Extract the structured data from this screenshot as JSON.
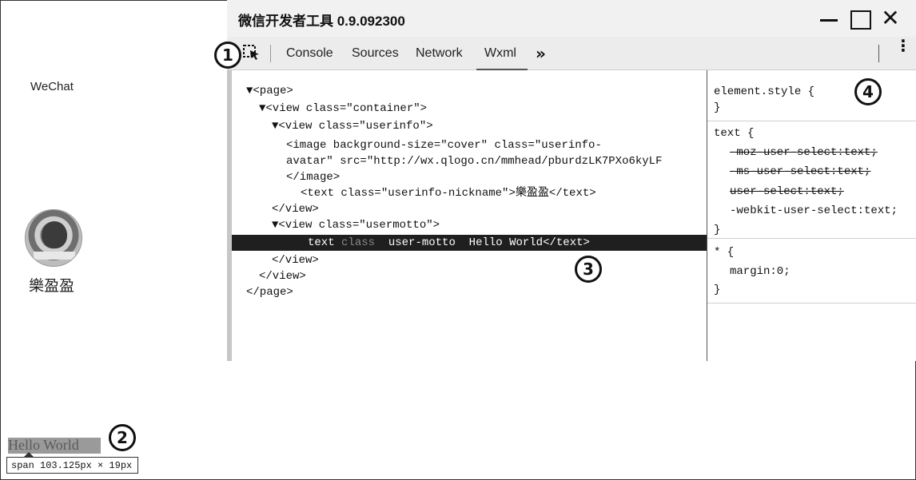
{
  "simulator": {
    "title": "WeChat",
    "nickname": "樂盈盈",
    "hello_text": "Hello World",
    "tooltip": "span 103.125px × 19px"
  },
  "window": {
    "title": "微信开发者工具 0.9.092300",
    "minimize_icon": "minimize-icon",
    "maximize_icon": "maximize-icon",
    "close_icon": "close-icon",
    "close_glyph": "✕"
  },
  "tabs": {
    "items": [
      "Console",
      "Sources",
      "Network",
      "Wxml"
    ],
    "active": "Wxml",
    "more_glyph": "»",
    "menu_glyph": "⋮"
  },
  "tree": {
    "lines": [
      "▼<page>",
      "▼<view class=\"container\">",
      "▼<view class=\"userinfo\">",
      "<image background-size=\"cover\" class=\"userinfo-",
      "avatar\" src=\"http://wx.qlogo.cn/mmhead/pburdzLK7PXo6kyLF",
      "</image>",
      "<text class=\"userinfo-nickname\">樂盈盈</text>",
      "</view>",
      "▼<view class=\"usermotto\">",
      "</view>",
      "</view>",
      "</page>"
    ],
    "selected": {
      "tag": "text",
      "attr": "class",
      "value": "user-motto",
      "content": "Hello World</text>"
    }
  },
  "styles": {
    "element_style_open": "element.style {",
    "close_brace": "}",
    "text_selector": "text {",
    "text_props": [
      "-moz-user-select:text;",
      "-ms-user-select:text;",
      "user-select:text;",
      "-webkit-user-select:text;"
    ],
    "star_selector": "* {",
    "star_props": [
      "margin:0;"
    ]
  },
  "callouts": [
    "1",
    "2",
    "3",
    "4"
  ]
}
